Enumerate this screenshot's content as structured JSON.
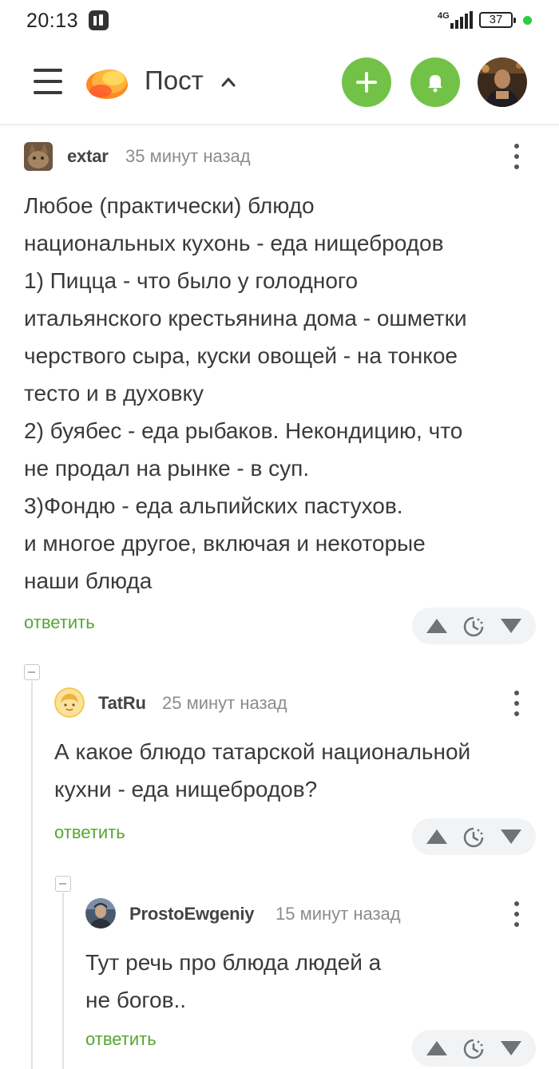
{
  "status_bar": {
    "time": "20:13",
    "network": "4G",
    "battery": "37"
  },
  "header": {
    "title": "Пост",
    "accent_color": "#72c247"
  },
  "comments": [
    {
      "author": "extar",
      "time": "35 минут назад",
      "text": "Любое (практически) блюдо\nнациональных кухонь - еда нищебродов\n1) Пицца - что было у голодного\nитальянского крестьянина дома - ошметки\nчерствого сыра, куски овощей - на тонкое\nтесто и в духовку\n2) буябес - еда рыбаков. Некондицию, что\nне продал на рынке - в суп.\n3)Фондю - еда альпийских пастухов.\nи многое другое, включая и некоторые\nнаши блюда",
      "reply_label": "ответить"
    },
    {
      "author": "TatRu",
      "time": "25 минут назад",
      "text": "А какое блюдо татарской национальной\nкухни - еда нищебродов?",
      "reply_label": "ответить"
    },
    {
      "author": "ProstoEwgeniy",
      "time": "15 минут назад",
      "text": "Тут речь про блюда людей а\nне богов..",
      "reply_label": "ответить"
    }
  ],
  "icons": {
    "vote_up": "triangle-up-icon",
    "vote_later": "clock-icon",
    "vote_down": "triangle-down-icon"
  }
}
